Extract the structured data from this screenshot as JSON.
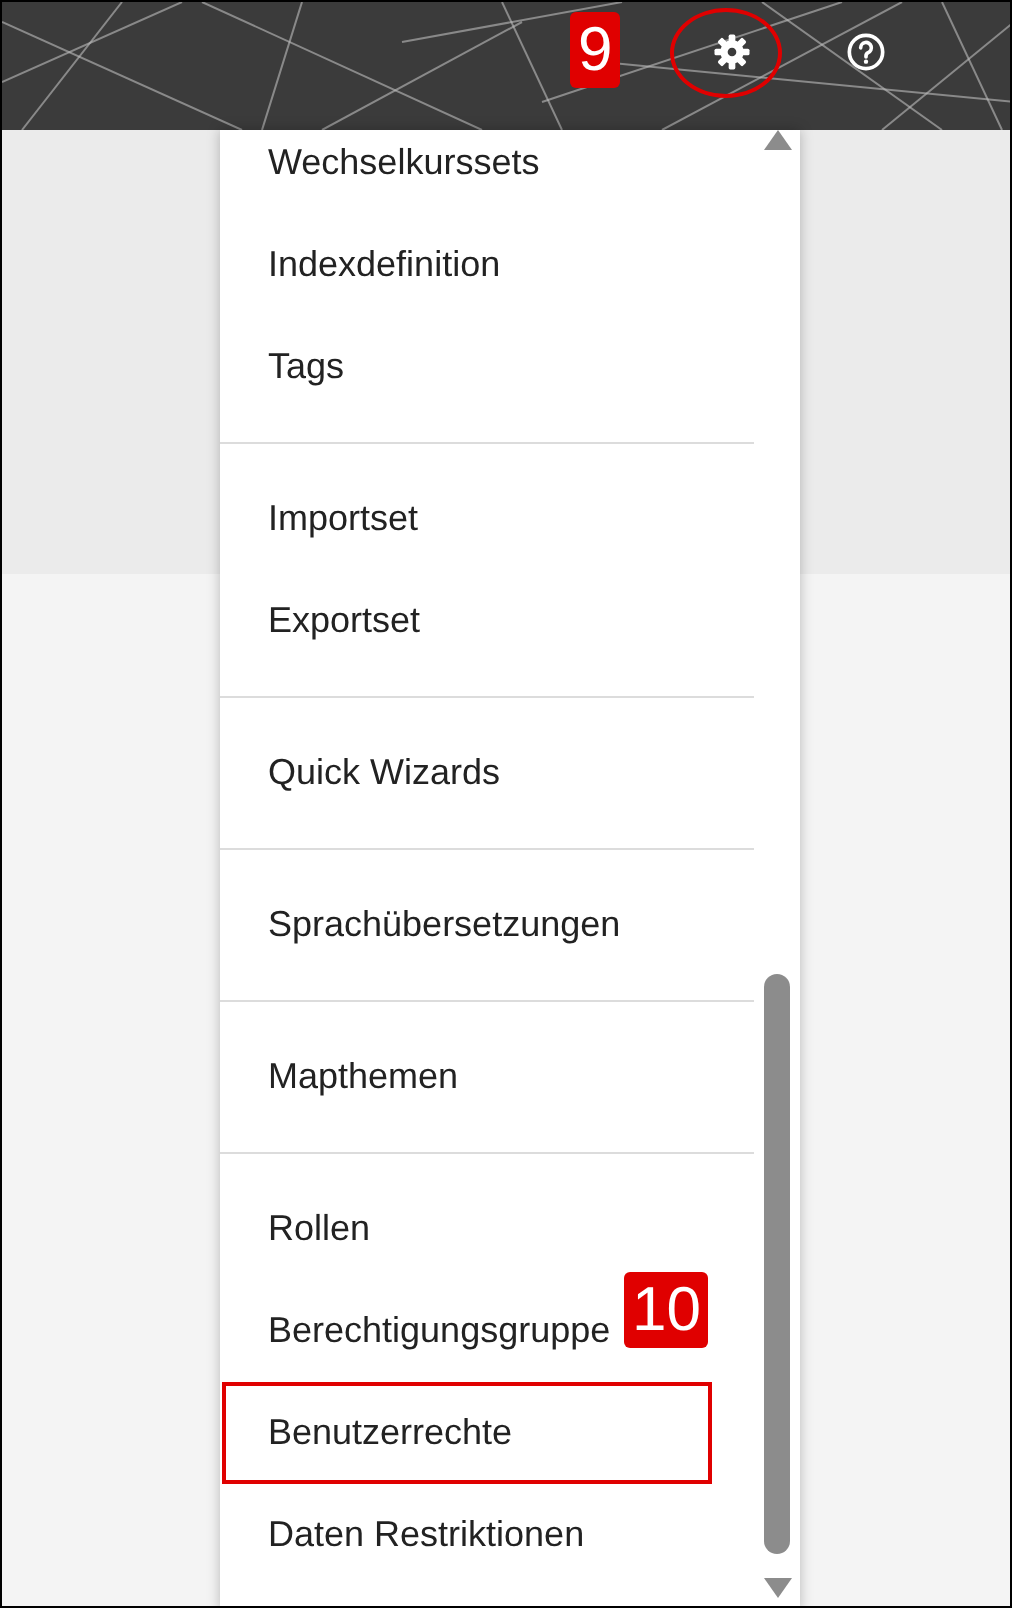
{
  "header": {
    "annotation_badge": "9",
    "settings_circled": true
  },
  "menu": {
    "groups": [
      {
        "items": [
          {
            "label": "Wechselkurssets",
            "highlighted": false
          },
          {
            "label": "Indexdefinition",
            "highlighted": false
          },
          {
            "label": "Tags",
            "highlighted": false
          }
        ]
      },
      {
        "items": [
          {
            "label": "Importset",
            "highlighted": false
          },
          {
            "label": "Exportset",
            "highlighted": false
          }
        ]
      },
      {
        "items": [
          {
            "label": "Quick Wizards",
            "highlighted": false
          }
        ]
      },
      {
        "items": [
          {
            "label": "Sprachübersetzungen",
            "highlighted": false
          }
        ]
      },
      {
        "items": [
          {
            "label": "Mapthemen",
            "highlighted": false
          }
        ]
      },
      {
        "items": [
          {
            "label": "Rollen",
            "highlighted": false
          },
          {
            "label": "Berechtigungsgruppe",
            "highlighted": false,
            "badge": "10"
          },
          {
            "label": "Benutzerrechte",
            "highlighted": true
          },
          {
            "label": "Daten Restriktionen",
            "highlighted": false
          }
        ]
      }
    ]
  }
}
